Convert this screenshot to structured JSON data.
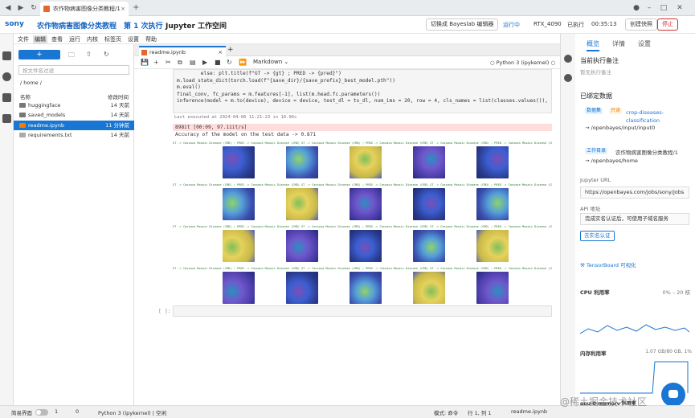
{
  "browser": {
    "tab_title": "农作物病害图像分类教程/1",
    "close_glyph": "×",
    "new_tab_glyph": "+",
    "nav_icons": [
      "back-icon",
      "forward-icon",
      "reload-icon",
      "info-icon"
    ]
  },
  "header": {
    "brand": "sony",
    "crumb_project": "农作物病害图像分类教程",
    "crumb_run": "第 1 次执行",
    "crumb_space": "Jupyter 工作空间",
    "switch_button": "切换成 Bayeslab 编辑器",
    "status": "运行中",
    "gpu": "RTX_4090",
    "elapsed_label": "已执行",
    "elapsed": "00:35:13",
    "snapshot_button": "创建快照",
    "stop_button": "停止"
  },
  "menu": [
    "文件",
    "编辑",
    "查看",
    "运行",
    "内核",
    "标签页",
    "设置",
    "帮助"
  ],
  "filebrowser": {
    "new_label": "+",
    "filter_placeholder": "按文件名过滤",
    "path": "/ home /",
    "col_name": "名称",
    "col_modified": "修改时间",
    "rows": [
      {
        "name": "huggingface",
        "modified": "14 天前",
        "type": "folder"
      },
      {
        "name": "saved_models",
        "modified": "14 天前",
        "type": "folder"
      },
      {
        "name": "readme.ipynb",
        "modified": "11 分钟前",
        "type": "notebook",
        "selected": true
      },
      {
        "name": "requirements.txt",
        "modified": "14 天前",
        "type": "file"
      }
    ]
  },
  "notebook": {
    "tab": "readme.ipynb",
    "close_glyph": "×",
    "add_tab_glyph": "+",
    "cell_type": "Markdown",
    "kernel": "Python 3 (ipykernel)",
    "code_lines": [
      "        else: plt.title(f\"GT -> {gt} ; PRED -> {pred}\")",
      "",
      "m.load_state_dict(torch.load(f\"{save_dir}/{save_prefix}_best_model.pth\"))",
      "m.eval()",
      "final_conv, fc_params = m.features[-1], list(m.head.fc.parameters())",
      "inference(model = m.to(device), device = device, test_dl = ts_dl, num_ims = 20, row = 4, cls_names = list(classes.values()), fina"
    ],
    "last_executed": "Last executed at 2024-04-06 11:21:23 in 10.96s",
    "progress_output": "898it [00:09, 97.11it/s]",
    "accuracy_output": "Accuracy of the model on the test data -> 0.871",
    "caption": "GT -> Cassava Mosaic Disease (CMD) ; PRED -> Cassava Mosaic Disease (CMD)",
    "empty_prompt": "[ ]:"
  },
  "right_panel": {
    "tabs": [
      "概览",
      "详情",
      "设置"
    ],
    "remark_title": "当前执行备注",
    "remark_value": "暂无执行备注",
    "bound_title": "已绑定数据",
    "dataset_tag": "数据集",
    "dataset_tag2": "只读",
    "dataset_name": "crop-diseases-classification",
    "dataset_mount": "/openbayes/input/input0",
    "workdir_tag": "工作目录",
    "workdir_name": "农作物病害图像分类教程/1",
    "workdir_mount": "/openbayes/home",
    "jupyter_label": "Jupyter URL",
    "jupyter_url": "https://openbayes.com/jobs/sony/jobs",
    "api_label": "API 地址",
    "api_value": "完成实名认证后，可使用子域名服务",
    "verify_button": "去实名认证",
    "tensorboard": "TensorBoard 可视化",
    "cpu_label": "CPU 利用率",
    "cpu_range": "0% – 20 核",
    "mem_label": "内存利用率",
    "mem_value": "1.07 GB/80 GB, 1%",
    "gpu_mem_label": "gpu-0-memory 利用率",
    "arrow_glyph": "→"
  },
  "statusbar": {
    "simple_mode": "简易界面",
    "n1": "1",
    "n2": "0",
    "kernel": "Python 3 (ipykernel) | 空闲",
    "mode": "模式: 命令",
    "position": "行 1, 列 1",
    "file": "readme.ipynb"
  },
  "watermark": "@稀土掘金技术社区",
  "colors": {
    "accent": "#1976d2",
    "stop": "#d32f2f",
    "error_bg": "#ffdddd"
  }
}
